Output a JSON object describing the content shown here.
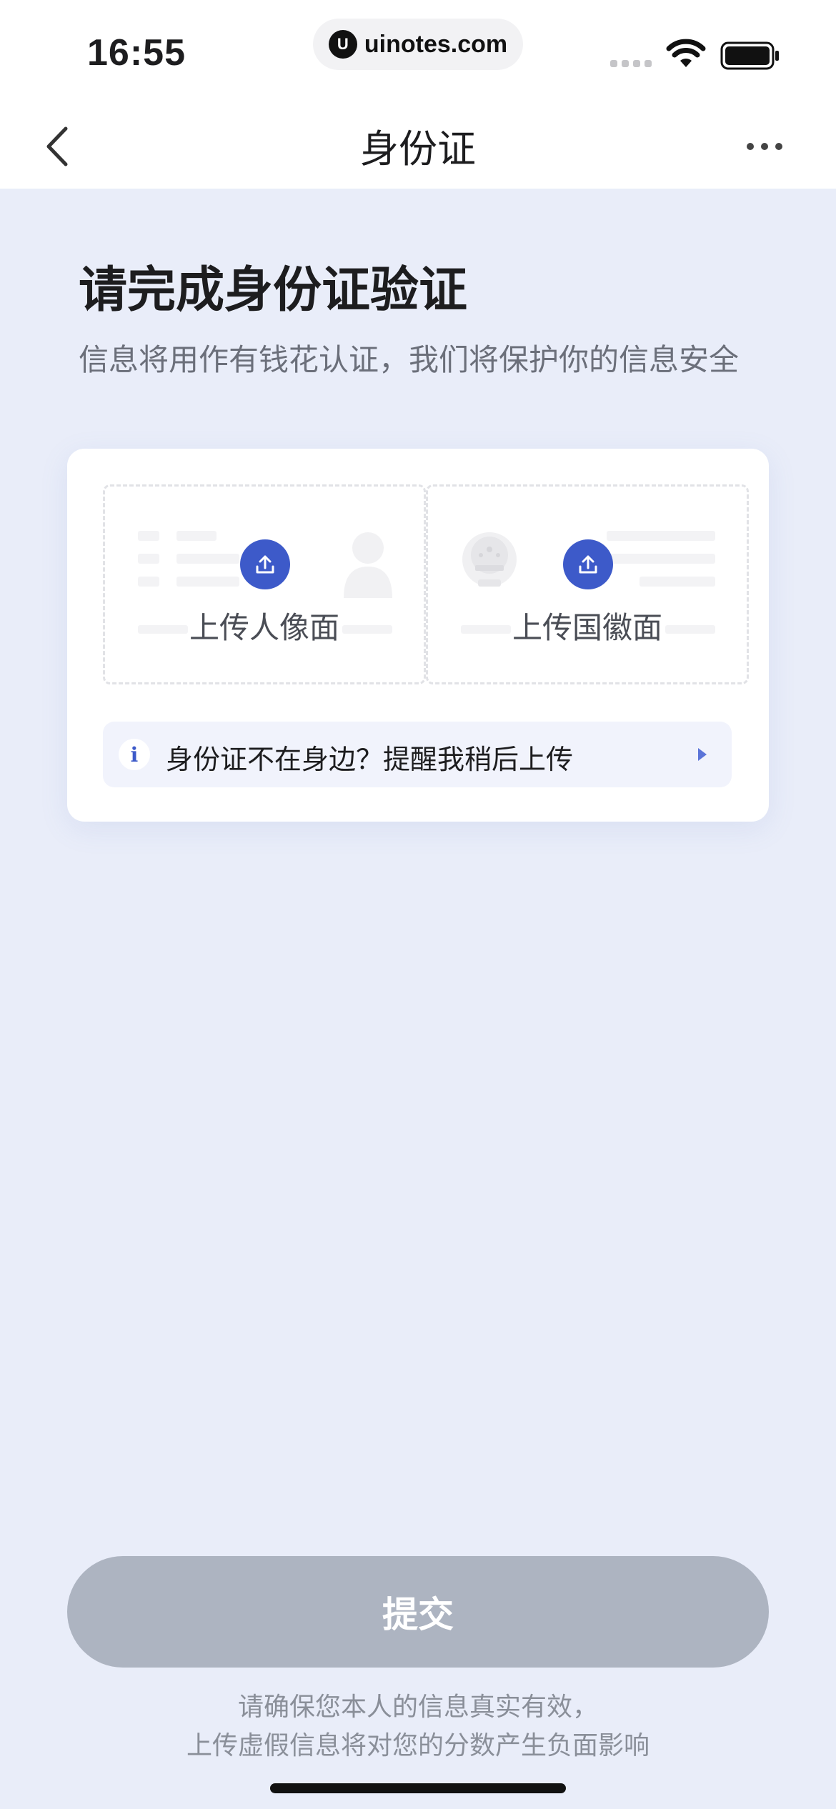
{
  "status_bar": {
    "time": "16:55",
    "url": "uinotes.com",
    "url_logo": "U",
    "icons": [
      "signal-icon",
      "wifi-icon",
      "battery-icon"
    ]
  },
  "nav": {
    "title": "身份证",
    "back_icon": "chevron-left-icon",
    "more_icon": "more-horizontal-icon"
  },
  "heading": "请完成身份证验证",
  "subtitle": "信息将用作有钱花认证，我们将保护你的信息安全",
  "upload": {
    "front_label": "上传人像面",
    "back_label": "上传国徽面",
    "icon": "upload-icon"
  },
  "reminder": {
    "icon_glyph": "i",
    "text": "身份证不在身边？提醒我稍后上传"
  },
  "submit": {
    "label": "提交"
  },
  "footnote": {
    "line1": "请确保您本人的信息真实有效，",
    "line2": "上传虚假信息将对您的分数产生负面影响"
  },
  "colors": {
    "background": "#e9edf9",
    "accent": "#3d5ac9",
    "submit_disabled": "#adb4c1"
  }
}
